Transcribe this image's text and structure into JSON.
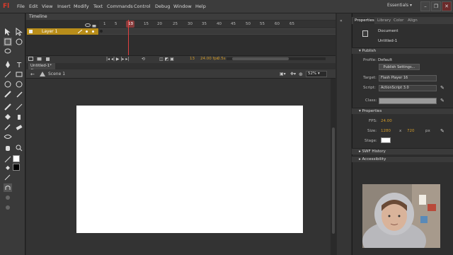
{
  "app": {
    "logo": "Fl"
  },
  "menu": [
    "File",
    "Edit",
    "View",
    "Insert",
    "Modify",
    "Text",
    "Commands",
    "Control",
    "Debug",
    "Window",
    "Help"
  ],
  "workspace": "Essentials",
  "window_controls": {
    "minimize": "–",
    "restore": "❐",
    "close": "✕"
  },
  "timeline": {
    "tab_label": "Timeline",
    "frame_numbers": [
      "1",
      "5",
      "10",
      "15",
      "20",
      "25",
      "30",
      "35",
      "40",
      "45",
      "50",
      "55",
      "60",
      "65"
    ],
    "current_frame": "13",
    "layer_name": "Layer 1",
    "footer_frame": "13",
    "footer_fps": "24.00 fps",
    "footer_time": "0.5s"
  },
  "document": {
    "tab_label": "Untitled-1*",
    "scene_label": "Scene 1",
    "zoom": "52%"
  },
  "properties_panel": {
    "tabs": [
      "Properties",
      "Library",
      "Color",
      "Align"
    ],
    "doc_type": "Document",
    "doc_name": "Untitled-1",
    "publish": {
      "header": "Publish",
      "profile_label": "Profile:",
      "profile_value": "Default",
      "settings_button": "Publish Settings...",
      "target_label": "Target:",
      "target_value": "Flash Player 16",
      "script_label": "Script:",
      "script_value": "ActionScript 3.0",
      "class_label": "Class:"
    },
    "properties": {
      "header": "Properties",
      "fps_label": "FPS:",
      "fps_value": "24.00",
      "size_label": "Size:",
      "width": "1280",
      "x": "x",
      "height": "720",
      "unit": "px",
      "stage_label": "Stage:"
    },
    "swf_history": "SWF History",
    "accessibility": "Accessibility"
  }
}
